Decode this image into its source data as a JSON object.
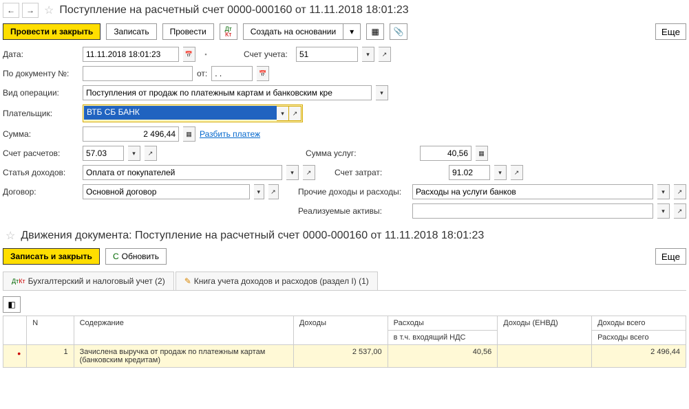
{
  "header": {
    "title": "Поступление на расчетный счет 0000-000160 от 11.11.2018 18:01:23"
  },
  "toolbar": {
    "post_close": "Провести и закрыть",
    "save": "Записать",
    "post": "Провести",
    "create_based": "Создать на основании",
    "more": "Еще"
  },
  "fields": {
    "date_label": "Дата:",
    "date": "11.11.2018 18:01:23",
    "doc_num_label": "По документу №:",
    "ot": "от:",
    "date2": ". .",
    "op_type_label": "Вид операции:",
    "op_type": "Поступления от продаж по платежным картам и банковским кре",
    "payer_label": "Плательщик:",
    "payer": "ВТБ СБ БАНК",
    "sum_label": "Сумма:",
    "sum": "2 496,44",
    "split": "Разбить платеж",
    "acct_calc_label": "Счет расчетов:",
    "acct_calc": "57.03",
    "income_item_label": "Статья доходов:",
    "income_item": "Оплата от покупателей",
    "contract_label": "Договор:",
    "contract": "Основной договор",
    "acct_ucheta_label": "Счет учета:",
    "acct_ucheta": "51",
    "service_sum_label": "Сумма услуг:",
    "service_sum": "40,56",
    "cost_acct_label": "Счет затрат:",
    "cost_acct": "91.02",
    "other_label": "Прочие доходы и расходы:",
    "other": "Расходы на услуги банков",
    "assets_label": "Реализуемые активы:"
  },
  "section2": {
    "title": "Движения документа: Поступление на расчетный счет 0000-000160 от 11.11.2018 18:01:23",
    "save_close": "Записать и закрыть",
    "refresh": "Обновить",
    "tab1": "Бухгалтерский и налоговый учет (2)",
    "tab2": "Книга учета доходов и расходов (раздел I) (1)"
  },
  "table": {
    "h_n": "N",
    "h_content": "Содержание",
    "h_income": "Доходы",
    "h_expense": "Расходы",
    "h_income_envd": "Доходы (ЕНВД)",
    "h_income_total": "Доходы всего",
    "h_nds": "в т.ч. входящий НДС",
    "h_expense_total": "Расходы всего",
    "r1_n": "1",
    "r1_content": "Зачислена выручка от продаж по платежным картам (банковским кредитам)",
    "r1_income": "2 537,00",
    "r1_expense": "40,56",
    "r1_total": "2 496,44"
  }
}
